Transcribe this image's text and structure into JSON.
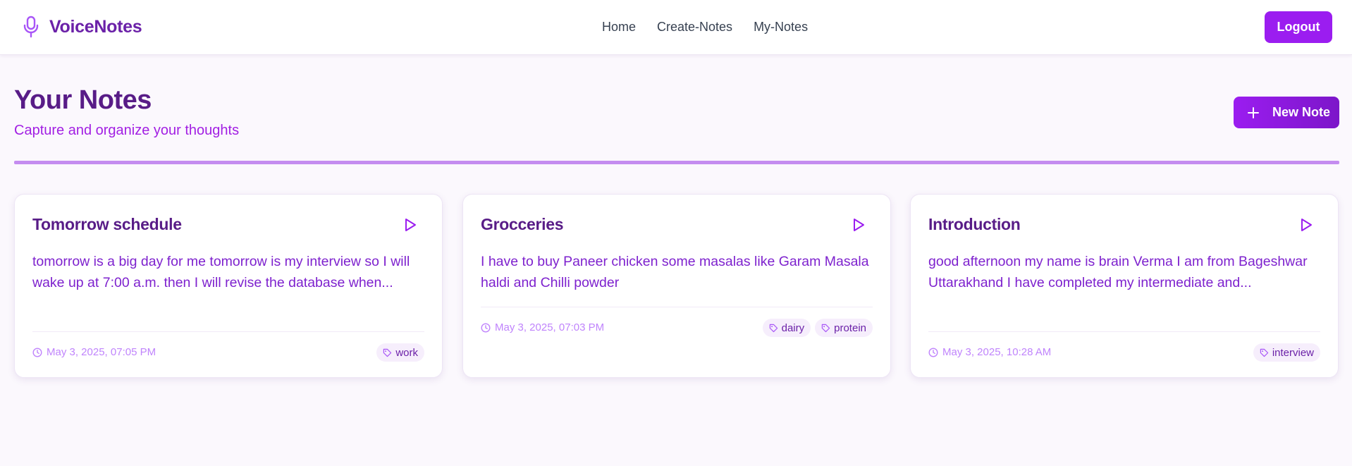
{
  "navbar": {
    "brand": "VoiceNotes",
    "links": [
      "Home",
      "Create-Notes",
      "My-Notes"
    ],
    "logout_label": "Logout"
  },
  "header": {
    "title": "Your Notes",
    "subtitle": "Capture and organize your thoughts",
    "new_note_label": "New Note"
  },
  "notes": [
    {
      "title": "Tomorrow schedule",
      "body": "tomorrow is a big day for me tomorrow is my interview so I will wake up at 7:00 a.m. then I will revise the database when...",
      "date": "May 3, 2025, 07:05 PM",
      "tags": [
        "work"
      ]
    },
    {
      "title": "Grocceries",
      "body": "I have to buy Paneer chicken some masalas like Garam Masala haldi and Chilli powder",
      "date": "May 3, 2025, 07:03 PM",
      "tags": [
        "dairy",
        "protein"
      ]
    },
    {
      "title": "Introduction",
      "body": "good afternoon my name is brain Verma I am from Bageshwar Uttarakhand I have completed my intermediate and...",
      "date": "May 3, 2025, 10:28 AM",
      "tags": [
        "interview"
      ]
    }
  ],
  "icons": {
    "brand": "microphone-icon",
    "new_note": "plus-icon",
    "play": "play-icon",
    "date": "clock-icon",
    "tag": "tag-icon"
  },
  "colors": {
    "brand_purple": "#6b21a8",
    "accent_purple": "#9b1df0",
    "title_purple": "#581c87",
    "divider": "#c48cf0"
  }
}
